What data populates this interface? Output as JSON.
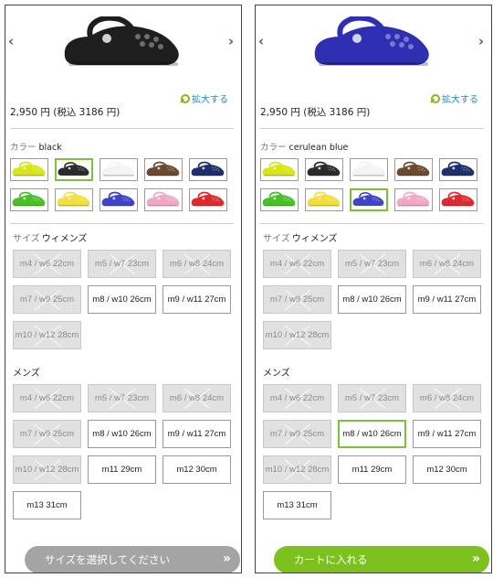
{
  "icons": {
    "prev": "chevron-left-icon",
    "next": "chevron-right-icon",
    "zoom": "magnifier-icon",
    "cta_arrow": "double-chevron-right-icon"
  },
  "colors": {
    "accent_green": "#7dc11e",
    "link_blue": "#1f8bc4",
    "disabled_gray": "#a4a4a4",
    "unavailable_bg": "#e1e1e1"
  },
  "swatch_colors": [
    "#d8e617",
    "#2b2b2b",
    "#f4f4f4",
    "#6b4a2f",
    "#1d2f6e",
    "#47c127",
    "#f2df3b",
    "#3f44c6",
    "#f2a8c4",
    "#dd2a2f"
  ],
  "panels": [
    {
      "product_color": "#1e1e1e",
      "prev": "‹",
      "next": "›",
      "zoom_label": "拡大する",
      "price": "2,950 円 (税込 3186 円)",
      "color_label": "カラー",
      "color_value": "black",
      "selected_swatch": 1,
      "womens_label": "サイズ",
      "womens_value": "ウィメンズ",
      "mens_label": "メンズ",
      "womens": [
        {
          "text": "m4 / w6 22cm",
          "state": "na"
        },
        {
          "text": "m5 / w7 23cm",
          "state": "na"
        },
        {
          "text": "m6 / w8 24cm",
          "state": "na"
        },
        {
          "text": "m7 / w9 25cm",
          "state": "na"
        },
        {
          "text": "m8 / w10 26cm",
          "state": "ok"
        },
        {
          "text": "m9 / w11 27cm",
          "state": "ok"
        },
        {
          "text": "m10 / w12 28cm",
          "state": "na"
        }
      ],
      "mens": [
        {
          "text": "m4 / w6 22cm",
          "state": "na"
        },
        {
          "text": "m5 / w7 23cm",
          "state": "na"
        },
        {
          "text": "m6 / w8 24cm",
          "state": "na"
        },
        {
          "text": "m7 / w9 25cm",
          "state": "na"
        },
        {
          "text": "m8 / w10 26cm",
          "state": "ok"
        },
        {
          "text": "m9 / w11 27cm",
          "state": "ok"
        },
        {
          "text": "m10 / w12 28cm",
          "state": "na"
        },
        {
          "text": "m11 29cm",
          "state": "ok"
        },
        {
          "text": "m12 30cm",
          "state": "ok"
        },
        {
          "text": "m13 31cm",
          "state": "ok"
        }
      ],
      "cta": "サイズを選択してください",
      "cta_state": "disabled",
      "cta_arrow": "»"
    },
    {
      "product_color": "#2f2fb3",
      "prev": "‹",
      "next": "›",
      "zoom_label": "拡大する",
      "price": "2,950 円 (税込 3186 円)",
      "color_label": "カラー",
      "color_value": "cerulean blue",
      "selected_swatch": 7,
      "womens_label": "サイズ",
      "womens_value": "ウィメンズ",
      "mens_label": "メンズ",
      "womens": [
        {
          "text": "m4 / w6 22cm",
          "state": "na"
        },
        {
          "text": "m5 / w7 23cm",
          "state": "na"
        },
        {
          "text": "m6 / w8 24cm",
          "state": "na"
        },
        {
          "text": "m7 / w9 25cm",
          "state": "na"
        },
        {
          "text": "m8 / w10 26cm",
          "state": "ok"
        },
        {
          "text": "m9 / w11 27cm",
          "state": "ok"
        },
        {
          "text": "m10 / w12 28cm",
          "state": "na"
        }
      ],
      "mens": [
        {
          "text": "m4 / w6 22cm",
          "state": "na"
        },
        {
          "text": "m5 / w7 23cm",
          "state": "na"
        },
        {
          "text": "m6 / w8 24cm",
          "state": "na"
        },
        {
          "text": "m7 / w9 25cm",
          "state": "na"
        },
        {
          "text": "m8 / w10 26cm",
          "state": "sel"
        },
        {
          "text": "m9 / w11 27cm",
          "state": "ok"
        },
        {
          "text": "m10 / w12 28cm",
          "state": "na"
        },
        {
          "text": "m11 29cm",
          "state": "ok"
        },
        {
          "text": "m12 30cm",
          "state": "ok"
        },
        {
          "text": "m13 31cm",
          "state": "ok"
        }
      ],
      "cta": "カートに入れる",
      "cta_state": "active",
      "cta_arrow": "»"
    }
  ]
}
